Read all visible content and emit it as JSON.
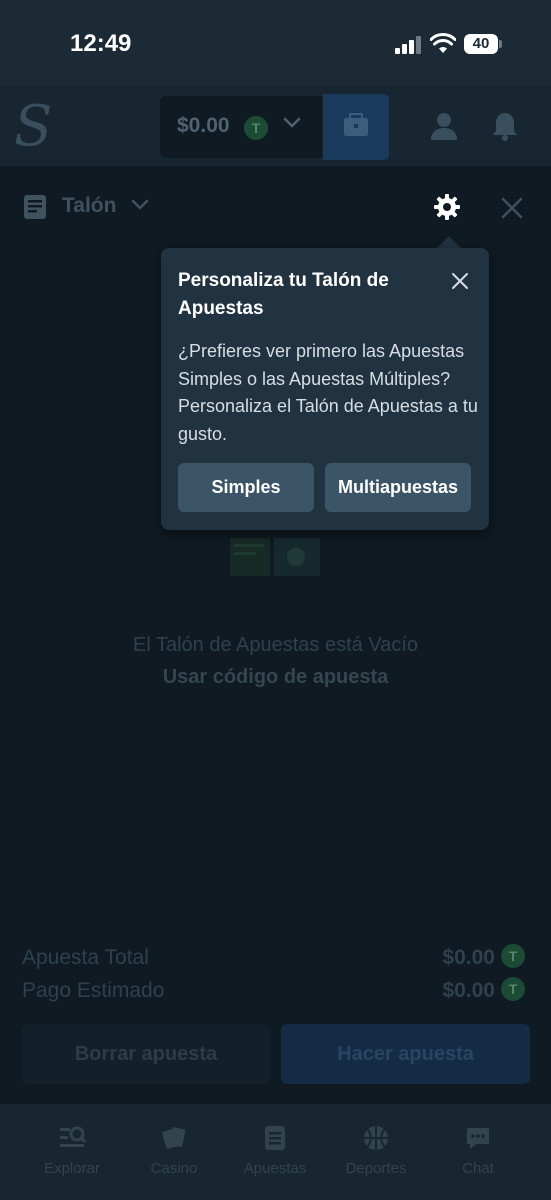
{
  "status_bar": {
    "time": "12:49",
    "battery": "40"
  },
  "header": {
    "logo": "S",
    "balance": "$0.00",
    "token": "T"
  },
  "slip": {
    "title": "Talón",
    "empty_message": "El Talón de Apuestas está Vacío",
    "use_code": "Usar código de apuesta",
    "total_stake_label": "Apuesta Total",
    "total_stake_value": "$0.00",
    "estimated_payout_label": "Pago Estimado",
    "estimated_payout_value": "$0.00",
    "token": "T",
    "clear_button": "Borrar apuesta",
    "place_button": "Hacer apuesta"
  },
  "popover": {
    "title": "Personaliza tu Talón de Apuestas",
    "body": "¿Prefieres ver primero las Apuestas Simples o las Apuestas Múltiples? Personaliza el Talón de Apuestas a tu gusto.",
    "simples_button": "Simples",
    "multi_button": "Multiapuestas"
  },
  "bottom_nav": {
    "items": [
      {
        "label": "Explorar",
        "icon": "explore-icon"
      },
      {
        "label": "Casino",
        "icon": "cards-icon"
      },
      {
        "label": "Apuestas",
        "icon": "betslip-icon"
      },
      {
        "label": "Deportes",
        "icon": "basketball-icon"
      },
      {
        "label": "Chat",
        "icon": "chat-icon"
      }
    ]
  },
  "colors": {
    "background": "#0f1a22",
    "popover": "#213340",
    "popover_button": "#3b5566",
    "accent_blue": "#1a3a5c",
    "token_green": "#1b4a35"
  }
}
